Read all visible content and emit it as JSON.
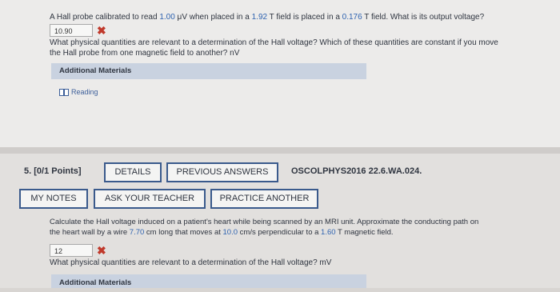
{
  "q4": {
    "line1_a": "A Hall probe calibrated to read ",
    "line1_n1": "1.00",
    "line1_b": " μV when placed in a ",
    "line1_n2": "1.92",
    "line1_c": " T field is placed in a ",
    "line1_n3": "0.176",
    "line1_d": " T field. What is its output voltage?",
    "answer_value": "10.90",
    "feedback_line1": "What physical quantities are relevant to a determination of the Hall voltage? Which of these quantities are constant if you move",
    "feedback_line2": "the Hall probe from one magnetic field to another? nV",
    "additional_materials": "Additional Materials",
    "reading_link": "Reading"
  },
  "q5": {
    "number": "5.",
    "points": "[0/1 Points]",
    "details_button": "DETAILS",
    "previous_answers_button": "PREVIOUS ANSWERS",
    "code": "OSCOLPHYS2016 22.6.WA.024.",
    "my_notes_button": "MY NOTES",
    "ask_teacher_button": "ASK YOUR TEACHER",
    "practice_another_button": "PRACTICE ANOTHER",
    "line1": "Calculate the Hall voltage induced on a patient's heart while being scanned by an MRI unit. Approximate the conducting path on",
    "line2_a": "the heart wall by a wire ",
    "line2_n1": "7.70",
    "line2_b": " cm long that moves at ",
    "line2_n2": "10.0",
    "line2_c": " cm/s perpendicular to a ",
    "line2_n3": "1.60",
    "line2_d": " T magnetic field.",
    "answer_value": "12",
    "feedback": "What physical quantities are relevant to a determination of the Hall voltage? mV",
    "additional_materials": "Additional Materials"
  },
  "icons": {
    "wrong": "x-mark-icon",
    "reading": "book-icon"
  },
  "colors": {
    "accent": "#2f63b0",
    "wrong": "#c0392b",
    "button_border": "#3a5a8c"
  }
}
